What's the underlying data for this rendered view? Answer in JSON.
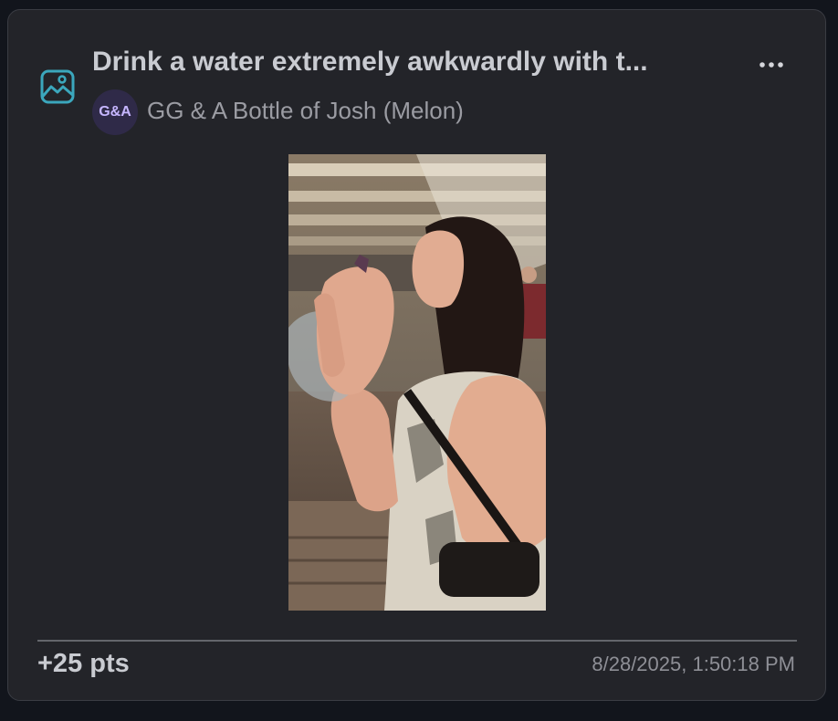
{
  "submission": {
    "title": "Drink a water extremely awkwardly with t...",
    "type_icon": "image-icon",
    "menu_icon": "more-horizontal-icon",
    "team": {
      "initials": "G&A",
      "name": "GG & A Bottle of Josh (Melon)"
    },
    "photo": {
      "description_icon": "photo"
    },
    "points": "+25 pts",
    "timestamp": "8/28/2025, 1:50:18 PM"
  },
  "colors": {
    "card_bg": "#232429",
    "page_bg": "#12151c",
    "icon_accent": "#3ba7bd",
    "avatar_bg": "#2f2a48",
    "avatar_text": "#c6b6ff",
    "title_text": "#c9cbd1",
    "muted_text": "#8e8f96"
  }
}
